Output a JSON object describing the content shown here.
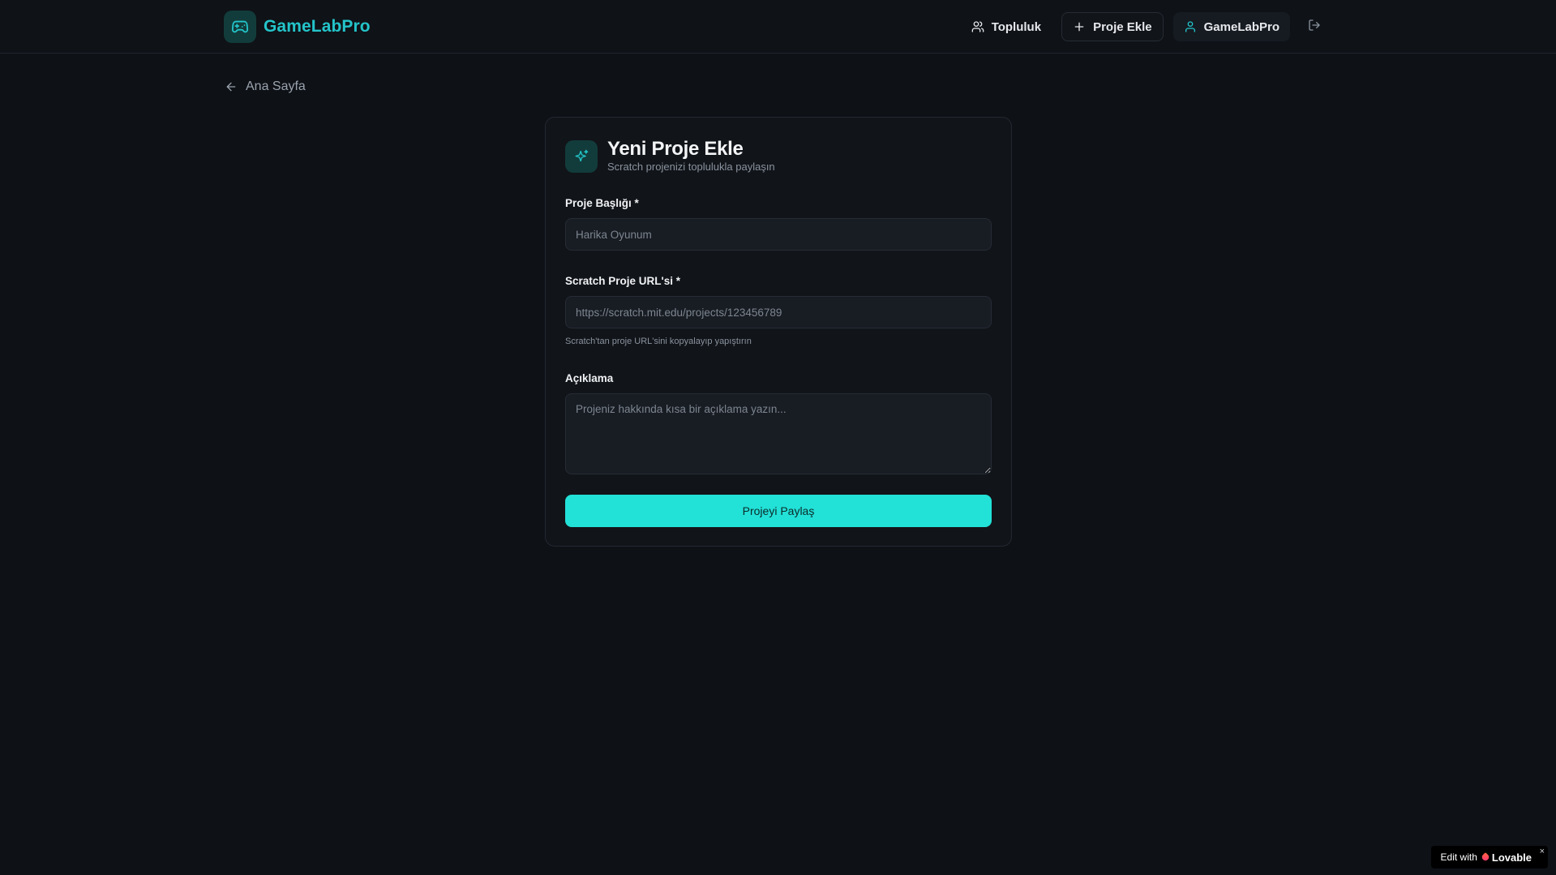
{
  "header": {
    "brand": "GameLabPro",
    "nav": {
      "community": "Topluluk",
      "add_project": "Proje Ekle",
      "user": "GameLabPro"
    }
  },
  "back_link": "Ana Sayfa",
  "form": {
    "title": "Yeni Proje Ekle",
    "subtitle": "Scratch projenizi toplulukla paylaşın",
    "project_title": {
      "label": "Proje Başlığı *",
      "value": "",
      "placeholder": "Harika Oyunum"
    },
    "scratch_url": {
      "label": "Scratch Proje URL'si *",
      "value": "",
      "placeholder": "https://scratch.mit.edu/projects/123456789",
      "hint": "Scratch'tan proje URL'sini kopyalayıp yapıştırın"
    },
    "description": {
      "label": "Açıklama",
      "value": "",
      "placeholder": "Projeniz hakkında kısa bir açıklama yazın..."
    },
    "submit_label": "Projeyi Paylaş"
  },
  "lovable_badge": {
    "prefix": "Edit with",
    "brand": "Lovable",
    "close": "×"
  },
  "icons": {
    "brand_logo": "gamepad-icon",
    "community": "users-icon",
    "add_project": "plus-icon",
    "user": "user-icon",
    "logout": "logout-icon",
    "back": "arrow-left-icon",
    "form_badge": "sparkles-icon"
  },
  "colors": {
    "background": "#0e1116",
    "accent": "#23c4c9",
    "button": "#22e1d7",
    "card": "#111419"
  }
}
